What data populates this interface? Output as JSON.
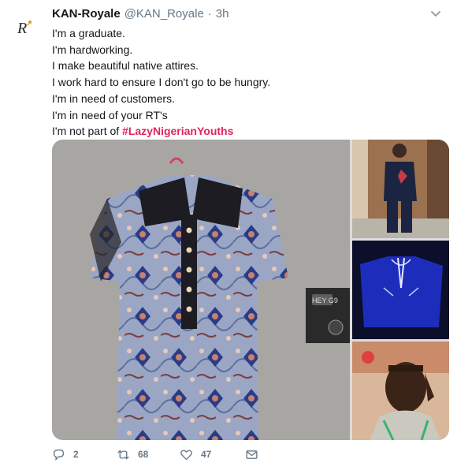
{
  "author": {
    "name": "KAN-Royale",
    "handle": "@KAN_Royale",
    "separator": "·",
    "time": "3h",
    "avatar_icon": "kan-royale-logo-avatar",
    "avatar_letter": "R"
  },
  "tweet": {
    "lines": [
      "I'm a graduate.",
      "I'm hardworking.",
      "I make beautiful native attires.",
      "I work hard to ensure I don't go to be hungry.",
      "I'm in need of customers.",
      "I'm in need of your RT's"
    ],
    "last_line_prefix": "I'm not part of ",
    "hashtag": "#LazyNigerianYouths"
  },
  "media": {
    "images": [
      {
        "name": "native-attire-shirt-photo"
      },
      {
        "name": "person-wearing-native-attire-photo"
      },
      {
        "name": "embroidered-blue-attire-photo"
      },
      {
        "name": "tailor-selfie-photo"
      }
    ],
    "clock_text": "HEY G9"
  },
  "actions": {
    "reply_count": "2",
    "retweet_count": "68",
    "like_count": "47"
  },
  "colors": {
    "hashtag": "#e0245e",
    "muted": "#657786",
    "text": "#14171a"
  }
}
